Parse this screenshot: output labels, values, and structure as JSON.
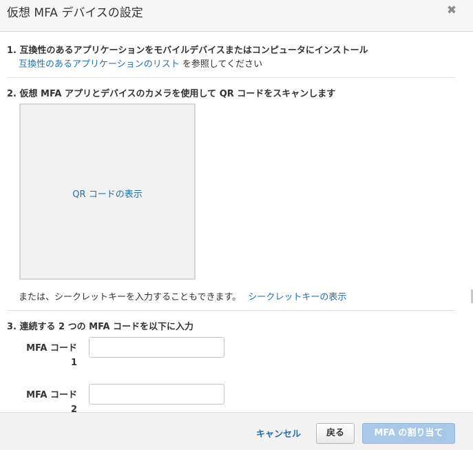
{
  "dialog": {
    "title": "仮想 MFA デバイスの設定",
    "close_icon": "close-icon",
    "close_glyph": "✖"
  },
  "step1": {
    "title": "1. 互換性のあるアプリケーションをモバイルデバイスまたはコンピュータにインストール",
    "link": "互換性のあるアプリケーションのリスト",
    "suffix": " を参照してください"
  },
  "step2": {
    "title": "2. 仮想 MFA アプリとデバイスのカメラを使用して QR コードをスキャンします",
    "qr_link": "QR コードの表示",
    "alt_text": "または、シークレットキーを入力することもできます。",
    "secret_link": "シークレットキーの表示"
  },
  "step3": {
    "title": "3. 連続する 2 つの MFA コードを以下に入力",
    "field1_label_a": "MFA コード",
    "field1_label_b": "1",
    "field1_value": "",
    "field2_label_a": "MFA コード",
    "field2_label_b": "2",
    "field2_value": ""
  },
  "footer": {
    "cancel_label": "キャンセル",
    "back_label": "戻る",
    "assign_label": "MFA の割り当て"
  },
  "colors": {
    "link": "#1f6fb2",
    "primary_disabled": "#a9c8e8",
    "header_bg": "#f7f7f7",
    "footer_bg": "#f2f2f2"
  }
}
